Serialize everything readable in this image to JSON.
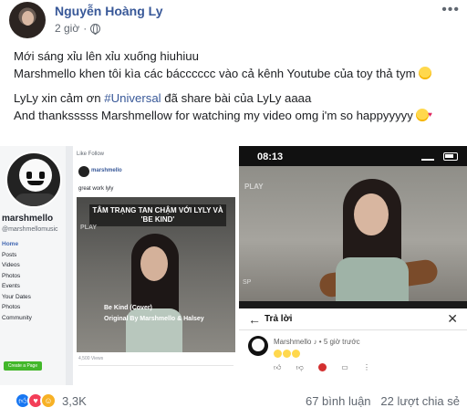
{
  "post": {
    "author": "Nguyễn Hoàng Ly",
    "time": "2 giờ",
    "privacy_icon": "globe-icon",
    "lines": [
      "Mới sáng xỉu lên xỉu xuống hiuhiuu",
      "Marshmello khen tôi kìa các bácccccc vào cả kênh Youtube của toy thả tym",
      "LyLy xin cảm ơn ",
      "#Universal",
      " đã share bài của LyLy aaaa",
      "And thanksssss Marshmellow for watching my video omg i'm so happyyyyy"
    ]
  },
  "left_image": {
    "page_name": "marshmello",
    "page_handle": "@marshmellomusic",
    "menu": [
      "Home",
      "Posts",
      "Videos",
      "Photos",
      "Events",
      "Your Dates",
      "Photos",
      "Community"
    ],
    "create_page": "Create a Page",
    "post_top": "Like   Follow",
    "post_author": "marshmello",
    "post_time": "",
    "post_caption": "great work lyly",
    "video_title": "TÂM TRẠNG TAN CHẬM VỚI LYLY VÀ 'BE KIND'",
    "play_tag": "PLAY",
    "caption_1": "Be Kind (Cover)",
    "caption_2": "Original By Marshmello & Halsey",
    "views": "4,500 Views"
  },
  "right_image": {
    "time": "08:13",
    "play_tag": "PLAY",
    "sp_tag": "SP",
    "reply_title": "Trả lời",
    "reply_author": "Marshmello ♪ • 5 giờ trước"
  },
  "footer": {
    "reaction_count": "3,3K",
    "comments": "67 bình luận",
    "shares": "22 lượt chia sẻ"
  }
}
